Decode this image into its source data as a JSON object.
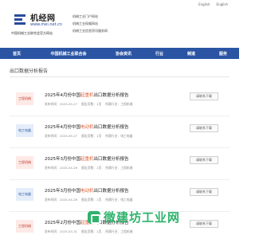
{
  "topbar": {
    "links": [
      "English",
      "English"
    ]
  },
  "logo": {
    "name_cn": "机经网",
    "url": "www.mei.net.cn",
    "org_name": "中国机械工业联合会官方网站"
  },
  "header_links": [
    "机械工业门户网站",
    "机械工业权威网站",
    "机械工业信息资讯服务网"
  ],
  "nav": [
    "首页",
    "中国机械工业联合会",
    "协会资讯",
    "行业",
    "频道",
    "服务"
  ],
  "page": {
    "title": "出口数据分析报告"
  },
  "reports": [
    {
      "tag": "工程机械",
      "tag_style": "a",
      "title_pre": "2025年4月份中国",
      "title_hl": "起重机",
      "title_post": "出口数据分析报告",
      "date": "发布时间：2025-05-27",
      "info1": "报告页数：1页",
      "info2": "所属行业：工程机械",
      "button": "请联系下载"
    },
    {
      "tag": "电工电器",
      "tag_style": "b",
      "title_pre": "2025年4月份中国",
      "title_hl": "电动机",
      "title_post": "出口数据分析报告",
      "date": "发布时间：2025-05-27",
      "info1": "报告页数：1页",
      "info2": "所属行业：电工电器",
      "button": "请联系下载"
    },
    {
      "tag": "工程机械",
      "tag_style": "a",
      "title_pre": "2025年3月份中国",
      "title_hl": "起重机",
      "title_post": "出口数据分析报告",
      "date": "发布时间：2025-04-26",
      "info1": "报告页数：1页",
      "info2": "所属行业：工程机械",
      "button": "请联系下载"
    },
    {
      "tag": "电工电器",
      "tag_style": "b",
      "title_pre": "2025年3月份中国",
      "title_hl": "电动机",
      "title_post": "出口数据分析报告",
      "date": "发布时间：2025-04-26",
      "info1": "报告页数：1页",
      "info2": "所属行业：电工电器",
      "button": "请联系下载"
    },
    {
      "tag": "工程机械",
      "tag_style": "a",
      "title_pre": "2025年2月份中国",
      "title_hl": "起重机",
      "title_post": "出口数据分析报告",
      "date": "发布时间：2025-03-31",
      "info1": "报告页数：1页",
      "info2": "所属行业：工程机械",
      "button": "请联系下载"
    }
  ],
  "watermark": {
    "text": "微建坊工业网",
    "icon": "site-logo-icon",
    "color": "#2db36b"
  },
  "colors": {
    "nav": "#2b55a3",
    "highlight": "#e55c2f"
  }
}
